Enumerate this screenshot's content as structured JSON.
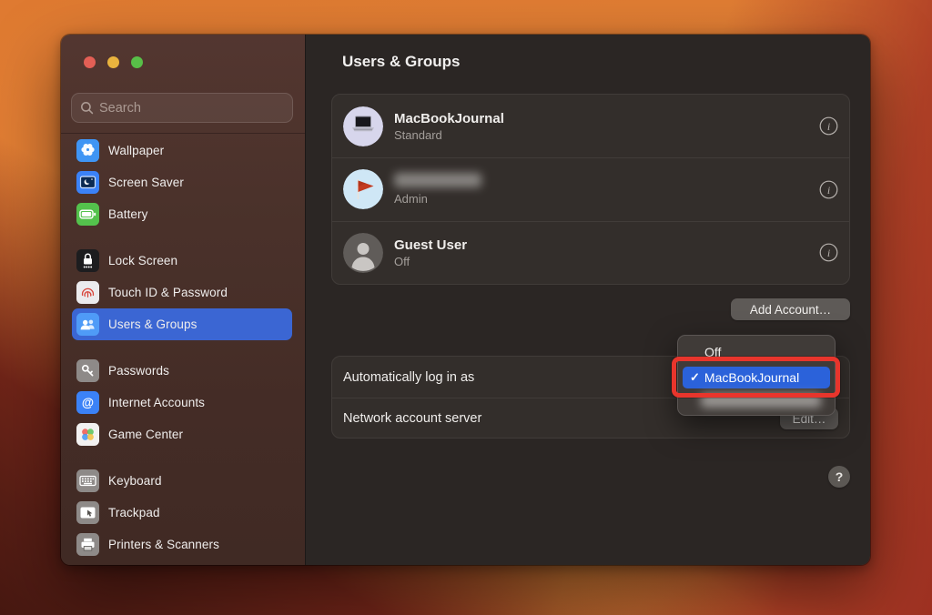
{
  "colors": {
    "accent_blue": "#3b66d3",
    "menu_highlight_blue": "#2b62da",
    "annotation_red": "#e8352c",
    "traffic_red": "#e35f55",
    "traffic_yellow": "#e9b33e",
    "traffic_green": "#58bf48"
  },
  "window": {
    "sidebar": {
      "search": {
        "placeholder": "Search"
      },
      "groups": [
        {
          "items": [
            {
              "label": "Wallpaper"
            },
            {
              "label": "Screen Saver"
            },
            {
              "label": "Battery"
            }
          ]
        },
        {
          "items": [
            {
              "label": "Lock Screen"
            },
            {
              "label": "Touch ID & Password"
            },
            {
              "label": "Users & Groups",
              "selected": true
            }
          ]
        },
        {
          "items": [
            {
              "label": "Passwords"
            },
            {
              "label": "Internet Accounts"
            },
            {
              "label": "Game Center"
            }
          ]
        },
        {
          "items": [
            {
              "label": "Keyboard"
            },
            {
              "label": "Trackpad"
            },
            {
              "label": "Printers & Scanners"
            }
          ]
        }
      ]
    },
    "content": {
      "title": "Users & Groups",
      "users": [
        {
          "name": "MacBookJournal",
          "role": "Standard",
          "avatar": "laptop"
        },
        {
          "name": "",
          "role": "Admin",
          "avatar": "red-flag",
          "redacted": true
        },
        {
          "name": "Guest User",
          "role": "Off",
          "avatar": "person"
        }
      ],
      "add_account_label": "Add Account…",
      "rows": [
        {
          "label": "Automatically log in as"
        },
        {
          "label": "Network account server",
          "action": "Edit…"
        }
      ],
      "dropdown": {
        "checkmark": "✓",
        "items": [
          {
            "label": "Off"
          },
          {
            "label": "MacBookJournal",
            "checked": true,
            "highlighted": true
          },
          {
            "label": "",
            "redacted": true
          }
        ]
      },
      "help_label": "?",
      "info_icon": "i"
    }
  }
}
